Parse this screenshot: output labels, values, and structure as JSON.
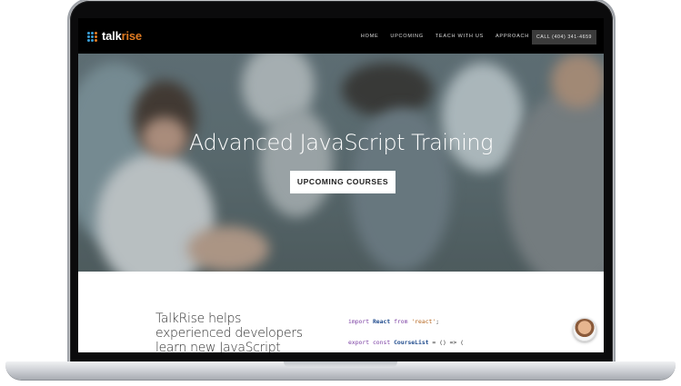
{
  "nav": {
    "logo_part1": "talk",
    "logo_part2": "rise",
    "items": [
      {
        "label": "HOME"
      },
      {
        "label": "UPCOMING"
      },
      {
        "label": "TEACH WITH US"
      },
      {
        "label": "APPROACH"
      }
    ],
    "call_label": "CALL (404) 341-4659"
  },
  "hero": {
    "title": "Advanced JavaScript Training",
    "button_label": "UPCOMING COURSES"
  },
  "intro": {
    "text": "TalkRise helps experienced developers learn new JavaScript frameworks."
  },
  "code": {
    "line1_kw1": "import",
    "line1_id": "React",
    "line1_kw2": "from",
    "line1_str": "'react'",
    "line1_end": ";",
    "line2_kw1": "export",
    "line2_kw2": "const",
    "line2_id": "CourseList",
    "line2_end": "= () => ("
  },
  "colors": {
    "accent": "#e07b22",
    "logo_dots": "#3aa0d8",
    "nav_bg": "#000000",
    "call_bg": "#3b3b3b"
  }
}
